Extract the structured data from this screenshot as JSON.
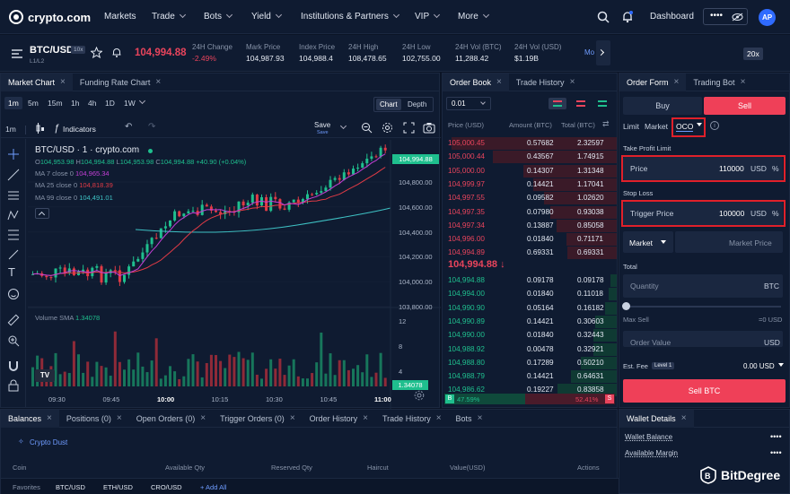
{
  "nav": {
    "logo_text": "crypto.com",
    "items": [
      "Markets",
      "Trade",
      "Bots",
      "Yield",
      "Institutions & Partners",
      "VIP",
      "More"
    ],
    "dashboard": "Dashboard",
    "masked": "••••",
    "avatar": "AP"
  },
  "ticker": {
    "pair": "BTC/USD",
    "leverage_badge": "10x",
    "sub": "L1/L2",
    "price": "104,994.88",
    "stats": [
      {
        "label": "24H Change",
        "value": "-2.49%"
      },
      {
        "label": "Mark Price",
        "value": "104,987.93"
      },
      {
        "label": "Index Price",
        "value": "104,988.4"
      },
      {
        "label": "24H High",
        "value": "108,478.65"
      },
      {
        "label": "24H Low",
        "value": "102,755.00"
      },
      {
        "label": "24H Vol (BTC)",
        "value": "11,288.42"
      },
      {
        "label": "24H Vol (USD)",
        "value": "$1.19B"
      }
    ],
    "more": "Mo",
    "leverage": "20x"
  },
  "chart_panel": {
    "tabs": [
      "Market Chart",
      "Funding Rate Chart"
    ],
    "intervals": [
      "1m",
      "5m",
      "15m",
      "1h",
      "4h",
      "1D",
      "1W"
    ],
    "view_toggle": [
      "Chart",
      "Depth"
    ],
    "indicators": "Indicators",
    "interval_sel": "1m",
    "save": "Save",
    "save_sub": "Save",
    "title": "BTC/USD · 1 · crypto.com",
    "ohlc": {
      "o_label": "O",
      "o": "104,953.98",
      "h_label": "H",
      "h": "104,994.88",
      "l_label": "L",
      "l": "104,953.98",
      "c_label": "C",
      "c": "104,994.88",
      "chg": "+40.90 (+0.04%)"
    },
    "ma": [
      {
        "label": "MA 7 close 0",
        "value": "104,965.34"
      },
      {
        "label": "MA 25 close 0",
        "value": "104,818.39"
      },
      {
        "label": "MA 99 close 0",
        "value": "104,491.01"
      }
    ],
    "volume_label": "Volume SMA",
    "volume_value": "1.34078",
    "price_tag": "104,994.88",
    "vol_tag": "1.34078",
    "logo": "TV",
    "time_ticks": [
      "09:30",
      "09:45",
      "10:00",
      "10:15",
      "10:30",
      "10:45",
      "11:00"
    ],
    "price_ticks": [
      "104,800.00",
      "104,600.00",
      "104,400.00",
      "104,200.00",
      "104,000.00",
      "103,800.00"
    ],
    "vol_ticks": [
      "12",
      "8",
      "4"
    ]
  },
  "chart_data": {
    "type": "candlestick",
    "x": [
      "09:30",
      "09:45",
      "10:00",
      "10:15",
      "10:30",
      "10:45",
      "11:00"
    ],
    "price_axis": [
      103800,
      104800
    ],
    "ma_series": [
      {
        "name": "MA 7 close 0",
        "color": "#c43fd6"
      },
      {
        "name": "MA 25 close 0",
        "color": "#e23b46"
      },
      {
        "name": "MA 99 close 0",
        "color": "#3ec1c4"
      }
    ],
    "last_price": 104994.88
  },
  "orderbook": {
    "tabs": [
      "Order Book",
      "Trade History"
    ],
    "precision": "0.01",
    "headers": [
      "Price (USD)",
      "Amount (BTC)",
      "Total (BTC)"
    ],
    "asks": [
      [
        "105,000.45",
        "0.57682",
        "2.32597"
      ],
      [
        "105,000.44",
        "0.43567",
        "1.74915"
      ],
      [
        "105,000.00",
        "0.14307",
        "1.31348"
      ],
      [
        "104,999.97",
        "0.14421",
        "1.17041"
      ],
      [
        "104,997.55",
        "0.09582",
        "1.02620"
      ],
      [
        "104,997.35",
        "0.07980",
        "0.93038"
      ],
      [
        "104,997.34",
        "0.13887",
        "0.85058"
      ],
      [
        "104,996.00",
        "0.01840",
        "0.71171"
      ],
      [
        "104,994.89",
        "0.69331",
        "0.69331"
      ]
    ],
    "mid": "104,994.88",
    "bids": [
      [
        "104,994.88",
        "0.09178",
        "0.09178"
      ],
      [
        "104,994.00",
        "0.01840",
        "0.11018"
      ],
      [
        "104,990.90",
        "0.05164",
        "0.16182"
      ],
      [
        "104,990.89",
        "0.14421",
        "0.30603"
      ],
      [
        "104,990.00",
        "0.01840",
        "0.32443"
      ],
      [
        "104,988.92",
        "0.00478",
        "0.32921"
      ],
      [
        "104,988.80",
        "0.17289",
        "0.50210"
      ],
      [
        "104,988.79",
        "0.14421",
        "0.64631"
      ],
      [
        "104,986.62",
        "0.19227",
        "0.83858"
      ]
    ],
    "buy_badge": "B",
    "buy_pct": "47.59%",
    "sell_pct": "52.41%",
    "sell_badge": "S",
    "buy_ratio": 0.4759
  },
  "order_form": {
    "tabs": [
      "Order Form",
      "Trading Bot"
    ],
    "buy": "Buy",
    "sell": "Sell",
    "types": [
      "Limit",
      "Market",
      "OCO"
    ],
    "tp_label": "Take Profit Limit",
    "price_label": "Price",
    "price_value": "110000",
    "price_unit": "USD",
    "stop_label": "Stop Loss",
    "trigger_label": "Trigger Price",
    "trigger_value": "100000",
    "trigger_unit": "USD",
    "market_sel": "Market",
    "market_price_placeholder": "Market Price",
    "total_label": "Total",
    "qty_label": "Quantity",
    "qty_unit": "BTC",
    "max_sell": "Max Sell",
    "max_sell_val": "=0 USD",
    "order_value": "Order Value",
    "order_value_unit": "USD",
    "est_fee": "Est. Fee",
    "level": "Level 1",
    "fee_val": "0.00 USD",
    "submit": "Sell BTC"
  },
  "bottom": {
    "tabs": [
      "Balances",
      "Positions (0)",
      "Open Orders (0)",
      "Trigger Orders (0)",
      "Order History",
      "Trade History",
      "Bots"
    ],
    "crypto_dust": "Crypto Dust",
    "columns": [
      "Coin",
      "Available Qty",
      "Reserved Qty",
      "Haircut",
      "Value(USD)",
      "Actions"
    ],
    "favorites_label": "Favorites",
    "favorites": [
      "BTC/USD",
      "ETH/USD",
      "CRO/USD"
    ],
    "add_all": "+ Add All"
  },
  "wallet": {
    "title": "Wallet Details",
    "balance": "Wallet Balance",
    "margin": "Available Margin",
    "masked": "••••"
  },
  "watermark": "BitDegree"
}
